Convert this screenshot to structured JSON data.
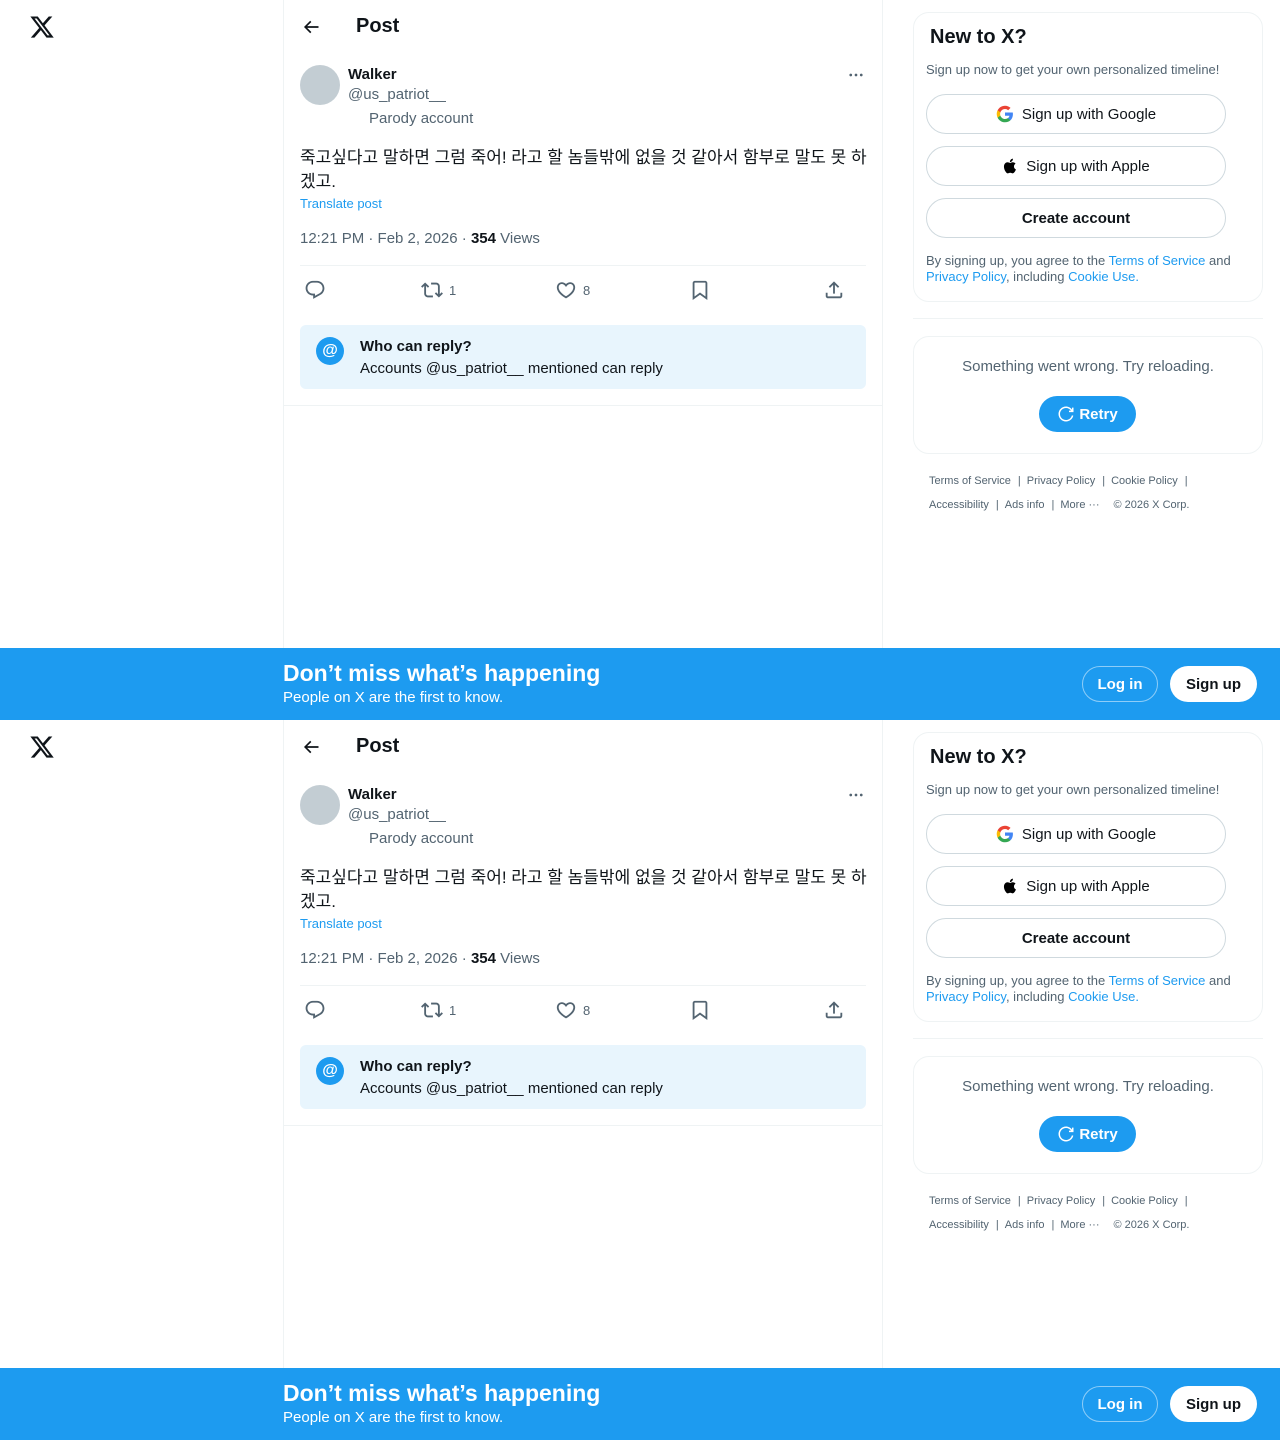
{
  "header": {
    "title": "Post"
  },
  "post": {
    "author_name": "Walker",
    "author_handle": "@us_patriot__",
    "label": "Parody account",
    "text": "죽고싶다고 말하면 그럼 죽어! 라고 할 놈들밖에 없을 것 같아서 함부로 말도 못 하겠고.",
    "translate": "Translate post",
    "timestamp": "12:21 PM · Feb 2, 2026",
    "dot": " · ",
    "views_count": "354",
    "views_label": " Views",
    "reposts": "1",
    "likes": "8"
  },
  "who_can_reply": {
    "icon": "@",
    "title": "Who can reply?",
    "subtitle": "Accounts @us_patriot__ mentioned can reply"
  },
  "signup_card": {
    "title": "New to X?",
    "subtitle": "Sign up now to get your own personalized timeline!",
    "google": "Sign up with Google",
    "apple": "Sign up with Apple",
    "create": "Create account",
    "legal_prefix": "By signing up, you agree to the ",
    "terms": "Terms of Service",
    "and": " and ",
    "privacy": "Privacy Policy",
    "including": ", including ",
    "cookie": "Cookie Use",
    "period": "."
  },
  "error_card": {
    "message": "Something went wrong. Try reloading.",
    "retry": "Retry"
  },
  "footer": {
    "terms": "Terms of Service",
    "privacy": "Privacy Policy",
    "cookie": "Cookie Policy",
    "accessibility": "Accessibility",
    "ads": "Ads info",
    "more": "More ···",
    "copyright": "© 2026 X Corp."
  },
  "banner": {
    "title": "Don’t miss what’s happening",
    "subtitle": "People on X are the first to know.",
    "login": "Log in",
    "signup": "Sign up"
  },
  "colors": {
    "accent": "#1d9bf0",
    "text": "#0f1419",
    "muted": "#536471",
    "who_box_bg": "#e8f5fd"
  },
  "icons": [
    "x-logo-icon",
    "back-arrow-icon",
    "more-icon",
    "reply-icon",
    "repost-icon",
    "like-icon",
    "bookmark-icon",
    "share-icon",
    "google-icon",
    "apple-icon",
    "refresh-icon"
  ]
}
